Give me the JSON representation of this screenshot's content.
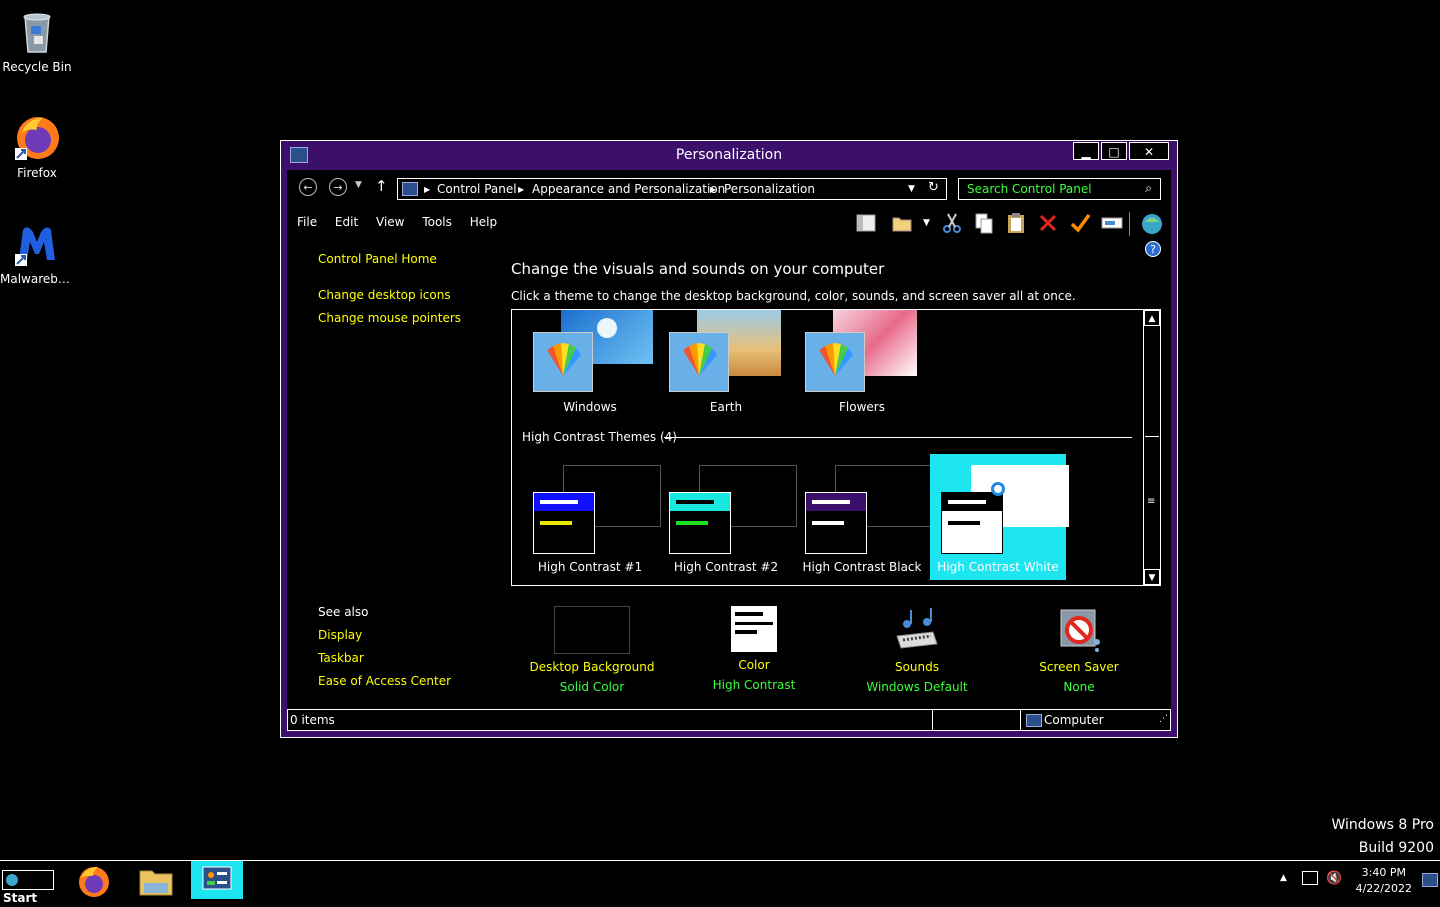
{
  "desktop": {
    "icons": [
      {
        "label": "Recycle Bin"
      },
      {
        "label": "Firefox"
      },
      {
        "label": "Malwareby..."
      }
    ],
    "watermark_line1": "Windows 8 Pro",
    "watermark_line2": "Build 9200"
  },
  "window": {
    "title": "Personalization",
    "buttons": {
      "minimize": "▁",
      "maximize": "□",
      "close": "✕"
    },
    "breadcrumb": [
      "Control Panel",
      "Appearance and Personalization",
      "Personalization"
    ],
    "search_placeholder": "Search Control Panel",
    "menu": [
      "File",
      "Edit",
      "View",
      "Tools",
      "Help"
    ],
    "sidebar": {
      "home": "Control Panel Home",
      "links": [
        "Change desktop icons",
        "Change mouse pointers"
      ],
      "see_also_title": "See also",
      "see_also": [
        "Display",
        "Taskbar",
        "Ease of Access Center"
      ]
    },
    "heading": "Change the visuals and sounds on your computer",
    "subheading": "Click a theme to change the desktop background, color, sounds, and screen saver all at once.",
    "themes": [
      "Windows",
      "Earth",
      "Flowers"
    ],
    "hc_group_title": "High Contrast Themes (4)",
    "hc_themes": [
      "High Contrast #1",
      "High Contrast #2",
      "High Contrast Black",
      "High Contrast White"
    ],
    "bottom": [
      {
        "title": "Desktop Background",
        "value": "Solid Color"
      },
      {
        "title": "Color",
        "value": "High Contrast"
      },
      {
        "title": "Sounds",
        "value": "Windows Default"
      },
      {
        "title": "Screen Saver",
        "value": "None"
      }
    ],
    "status": {
      "items": "0 items",
      "location": "Computer"
    }
  },
  "taskbar": {
    "start_label": "Start",
    "time": "3:40 PM",
    "date": "4/22/2022"
  },
  "colors": {
    "accent_purple": "#3c0f6b",
    "link_yellow": "#ffff00",
    "placeholder_green": "#3cff3c",
    "selection_cyan": "#1ee6f0"
  }
}
